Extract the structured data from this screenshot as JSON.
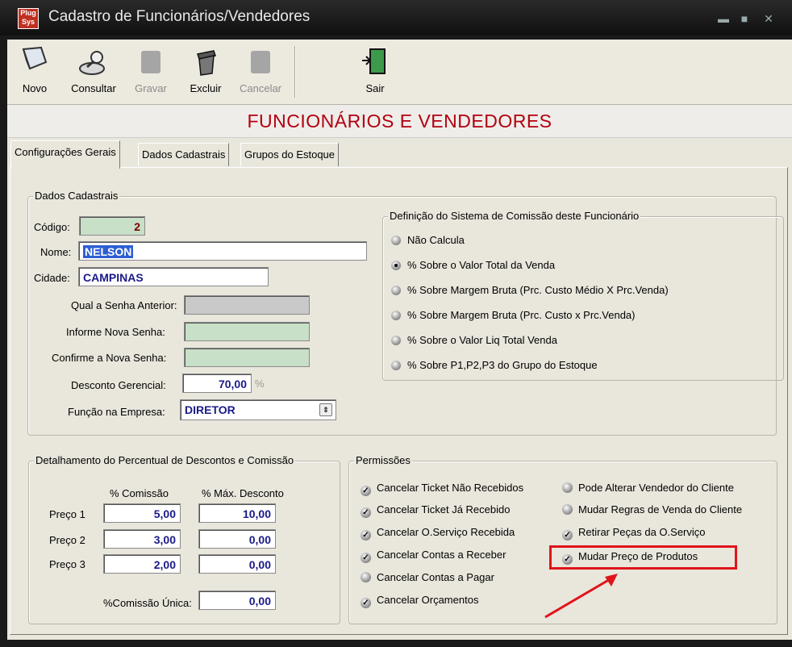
{
  "window": {
    "title": "Cadastro de Funcionários/Vendedores",
    "app_icon_text": "Plug Sys"
  },
  "toolbar": {
    "novo": "Novo",
    "consultar": "Consultar",
    "gravar": "Gravar",
    "excluir": "Excluir",
    "cancelar": "Cancelar",
    "sair": "Sair"
  },
  "heading": "FUNCIONÁRIOS E VENDEDORES",
  "tabs": [
    "Configurações Gerais",
    "Dados Cadastrais",
    "Grupos do Estoque"
  ],
  "dados": {
    "group_label": "Dados Cadastrais",
    "codigo_label": "Código:",
    "codigo_value": "2",
    "nome_label": "Nome:",
    "nome_value": "NELSON",
    "cidade_label": "Cidade:",
    "cidade_value": "CAMPINAS",
    "senha_anterior_label": "Qual a Senha Anterior:",
    "nova_senha_label": "Informe Nova Senha:",
    "confirme_label": "Confirme a Nova Senha:",
    "desconto_label": "Desconto Gerencial:",
    "desconto_value": "70,00",
    "desconto_unit": "%",
    "funcao_label": "Função na Empresa:",
    "funcao_value": "DIRETOR"
  },
  "comissao_sistema": {
    "group_label": "Definição do Sistema de Comissão deste Funcionário",
    "options": [
      "Não Calcula",
      "% Sobre o Valor Total da Venda",
      "% Sobre Margem Bruta (Prc. Custo Médio X Prc.Venda)",
      "% Sobre Margem Bruta (Prc. Custo x Prc.Venda)",
      "% Sobre o Valor Liq Total Venda",
      "% Sobre P1,P2,P3 do Grupo do Estoque"
    ],
    "selected_index": 1
  },
  "detalhamento": {
    "group_label": "Detalhamento do Percentual de Descontos e Comissão",
    "col_comissao": "% Comissão",
    "col_desconto": "% Máx. Desconto",
    "rows": [
      {
        "label": "Preço 1",
        "comissao": "5,00",
        "desconto": "10,00"
      },
      {
        "label": "Preço 2",
        "comissao": "3,00",
        "desconto": "0,00"
      },
      {
        "label": "Preço 3",
        "comissao": "2,00",
        "desconto": "0,00"
      }
    ],
    "unica_label": "%Comissão Única:",
    "unica_value": "0,00"
  },
  "permissoes": {
    "group_label": "Permissões",
    "left": [
      {
        "label": "Cancelar Ticket Não Recebidos",
        "checked": true
      },
      {
        "label": "Cancelar Ticket Já Recebido",
        "checked": true
      },
      {
        "label": "Cancelar O.Serviço Recebida",
        "checked": true
      },
      {
        "label": "Cancelar Contas a Receber",
        "checked": true
      },
      {
        "label": "Cancelar Contas a Pagar",
        "checked": false
      },
      {
        "label": "Cancelar Orçamentos",
        "checked": true
      }
    ],
    "right": [
      {
        "label": "Pode Alterar Vendedor do Cliente",
        "checked": false
      },
      {
        "label": "Mudar Regras de Venda do Cliente",
        "checked": false
      },
      {
        "label": "Retirar Peças da O.Serviço",
        "checked": true
      },
      {
        "label": "Mudar Preço de Produtos",
        "checked": true
      }
    ]
  },
  "colors": {
    "heading": "#b2000f",
    "highlight": "#e0141b",
    "field_green": "#c8dfc8"
  }
}
